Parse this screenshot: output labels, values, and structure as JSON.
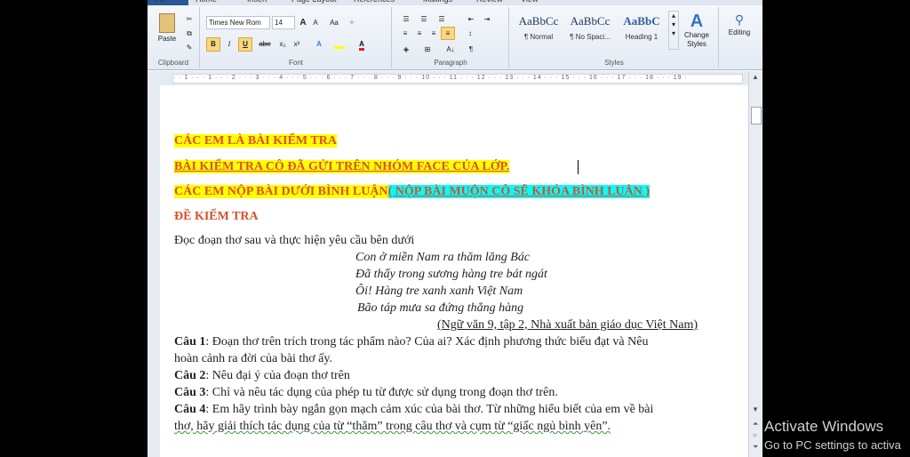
{
  "ribbon": {
    "tabs": [
      "File",
      "Home",
      "Insert",
      "Page Layout",
      "References",
      "Mailings",
      "Review",
      "View"
    ],
    "clipboard": {
      "paste_label": "Paste",
      "group_label": "Clipboard"
    },
    "font": {
      "name": "Times New Rom",
      "size": "14",
      "grow": "A",
      "shrink": "A",
      "change_case": "Aa",
      "bold": "B",
      "italic": "I",
      "underline": "U",
      "strike": "abe",
      "subscript": "x₂",
      "superscript": "x²",
      "group_label": "Font"
    },
    "paragraph": {
      "group_label": "Paragraph",
      "sort": "A↓",
      "pilcrow": "¶"
    },
    "styles": {
      "items": [
        {
          "sample": "AaBbCc",
          "name": "¶ Normal"
        },
        {
          "sample": "AaBbCc",
          "name": "¶ No Spaci..."
        },
        {
          "sample": "AaBbC",
          "name": "Heading 1"
        }
      ],
      "change_styles": "Change Styles",
      "group_label": "Styles"
    },
    "editing": {
      "label": "Editing"
    }
  },
  "ruler": {
    "marks": "· · 1 · · · 1 · · · 2 · · · 3 · · · 4 · · · 5 · · · 6 · · · 7 · · · 8 · · · 9 · · · 10 · · · 11 · · · 12 · · · 13 · · · 14 · · · 15 · · · 16 · · · 17 · · · 18 · · · 19 ·"
  },
  "document": {
    "line1": "CÁC EM LÀ BÀI KIỂM TRA",
    "line2": "BÀI KIỂM TRA CÔ ĐÃ GỬI TRÊN NHÓM FACE CỦA LỚP.",
    "line3a": "CÁC EM NỘP BÀI DƯỚI BÌNH LUẬN",
    "line3b": "( NỘP BÀI MUỘN CÔ SẼ KHÓA BÌNH LUẬN )",
    "heading": "ĐỀ KIỂM TRA",
    "intro": "Đọc đoạn thơ sau và thực hiện yêu cầu bên dưới",
    "poem": [
      "Con ở miền Nam ra thăm lăng Bác",
      "Đã thấy trong sương hàng tre bát ngát",
      "Ôi! Hàng tre xanh xanh Việt Nam",
      "Bão táp mưa sa đứng thẳng hàng"
    ],
    "source": "(Ngữ văn 9, tập 2, Nhà xuất bản giáo dục Việt Nam)",
    "questions": [
      {
        "label": "Câu 1",
        "text": ": Đoạn thơ trên trích trong tác phẩm nào? Của ai? Xác định phương thức biểu đạt và  Nêu"
      },
      {
        "label": "",
        "text": "hoàn cảnh ra đời của bài thơ ấy."
      },
      {
        "label": "Câu 2",
        "text": ": Nêu đại ý của đoạn thơ trên"
      },
      {
        "label": "Câu 3",
        "text": ": Chỉ và nêu tác dụng của phép tu từ được sử dụng trong đoạn thơ trên."
      },
      {
        "label": "Câu 4",
        "text": ": Em hãy trình bày ngắn gọn mạch cảm xúc của bài thơ. Từ những hiểu biết của em về bài"
      },
      {
        "label": "",
        "text": "thơ, hãy giải thích tác dụng của từ “thăm” trong câu thơ và cụm từ “giấc ngủ bình yên”."
      }
    ]
  },
  "watermark": {
    "title": "Activate Windows",
    "subtitle": "Go to PC settings to activa"
  }
}
